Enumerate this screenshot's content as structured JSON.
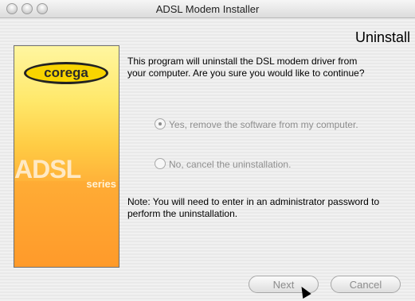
{
  "window": {
    "title": "ADSL Modem Installer"
  },
  "page": {
    "heading": "Uninstall"
  },
  "side_panel": {
    "logo_text": "corega",
    "brand_main": "ADSL",
    "brand_sub": "series"
  },
  "content": {
    "message": "This program will uninstall the DSL modem driver from\nyour computer.  Are you sure you would like to continue?",
    "options": [
      {
        "label": "Yes, remove the software from my computer.",
        "selected": true
      },
      {
        "label": "No, cancel the uninstallation.",
        "selected": false
      }
    ],
    "note": "Note: You will need to enter in an administrator password to perform the uninstallation."
  },
  "buttons": {
    "next": "Next",
    "cancel": "Cancel"
  },
  "icons": {
    "window_controls": [
      "close-button-icon",
      "minimize-button-icon",
      "zoom-button-icon"
    ],
    "pointer": "mouse-pointer-icon"
  },
  "colors": {
    "panel_gradient_top": "#fff6a0",
    "panel_gradient_bottom": "#ff9f2e"
  }
}
